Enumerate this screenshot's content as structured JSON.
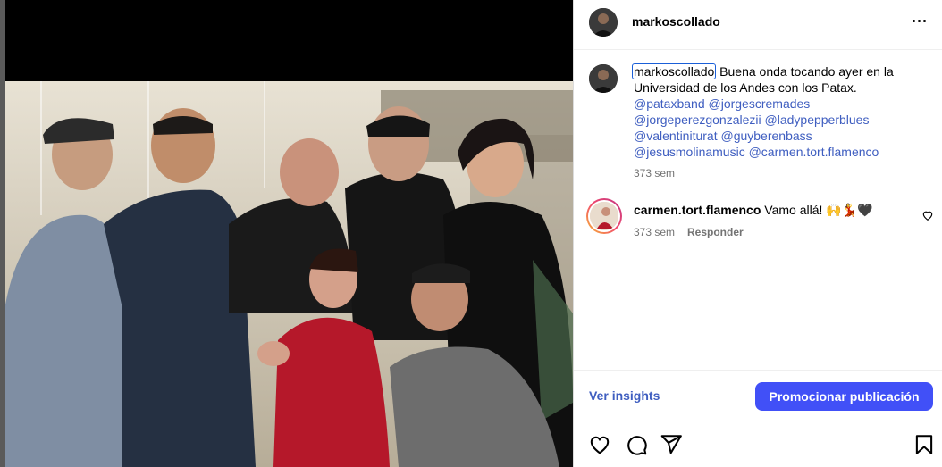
{
  "post": {
    "author": "markoscollado",
    "caption_text": "Buena onda tocando ayer en la Universidad de los Andes con los Patax.",
    "mentions": [
      "@pataxband",
      "@jorgescremades",
      "@jorgeperezgonzalezii",
      "@ladypepperblues",
      "@valentiniturat",
      "@guyberenbass",
      "@jesusmolinamusic",
      "@carmen.tort.flamenco"
    ],
    "caption_time": "373 sem"
  },
  "comment": {
    "username": "carmen.tort.flamenco",
    "text": "Vamo allá! 🙌💃🖤",
    "time": "373 sem",
    "reply_label": "Responder"
  },
  "insights": {
    "link_label": "Ver insights",
    "promote_label": "Promocionar publicación"
  },
  "icons": {
    "header_more": "more-horizontal-icon",
    "like": "heart-icon",
    "comment": "comment-bubble-icon",
    "share": "paper-plane-icon",
    "save": "bookmark-icon"
  },
  "colors": {
    "link_blue": "#3f5ec0",
    "button_blue": "#4150f7",
    "muted_text": "#737373",
    "dress_red": "#b5182a"
  }
}
